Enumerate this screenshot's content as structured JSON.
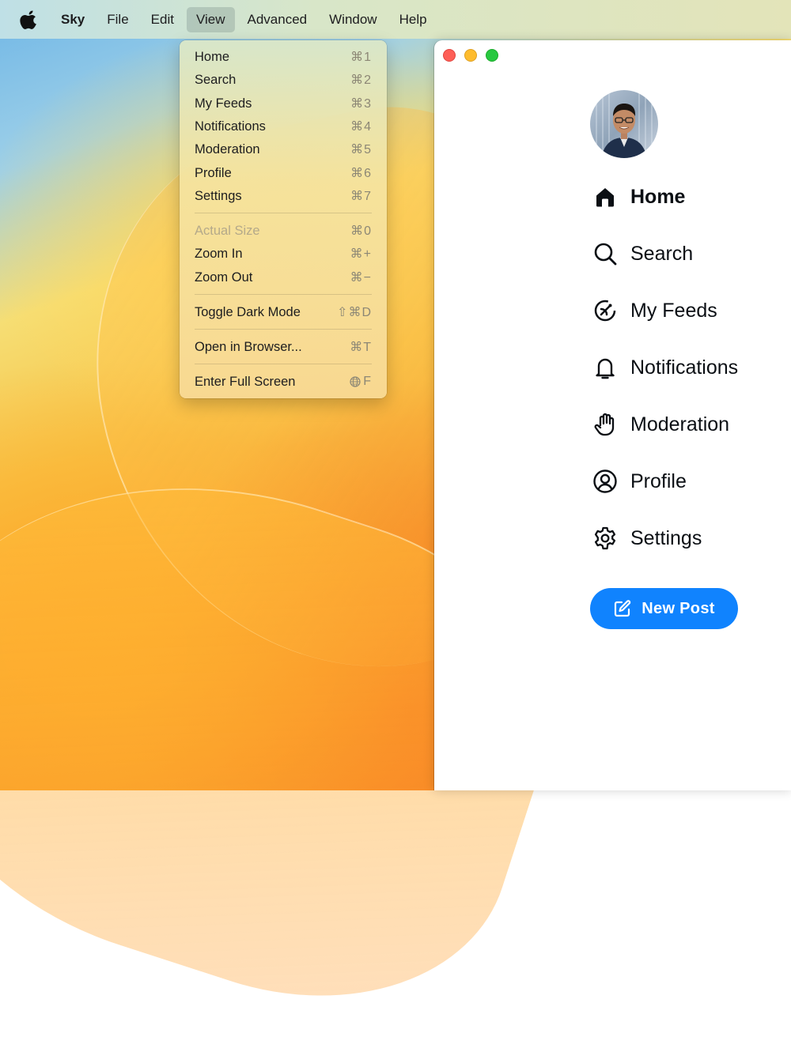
{
  "menubar": {
    "app_name": "Sky",
    "items": [
      "File",
      "Edit",
      "View",
      "Advanced",
      "Window",
      "Help"
    ],
    "active": "View"
  },
  "view_menu": {
    "items": [
      {
        "label": "Home",
        "shortcut": "⌘1",
        "enabled": true
      },
      {
        "label": "Search",
        "shortcut": "⌘2",
        "enabled": true
      },
      {
        "label": "My Feeds",
        "shortcut": "⌘3",
        "enabled": true
      },
      {
        "label": "Notifications",
        "shortcut": "⌘4",
        "enabled": true
      },
      {
        "label": "Moderation",
        "shortcut": "⌘5",
        "enabled": true
      },
      {
        "label": "Profile",
        "shortcut": "⌘6",
        "enabled": true
      },
      {
        "label": "Settings",
        "shortcut": "⌘7",
        "enabled": true
      },
      {
        "label": "Actual Size",
        "shortcut": "⌘0",
        "enabled": false
      },
      {
        "label": "Zoom In",
        "shortcut": "⌘+",
        "enabled": true
      },
      {
        "label": "Zoom Out",
        "shortcut": "⌘−",
        "enabled": true
      },
      {
        "label": "Toggle Dark Mode",
        "shortcut": "⇧⌘D",
        "enabled": true
      },
      {
        "label": "Open in Browser...",
        "shortcut": "⌘T",
        "enabled": true
      },
      {
        "label": "Enter Full Screen",
        "shortcut": "F",
        "enabled": true
      }
    ]
  },
  "sidebar": {
    "items": [
      {
        "label": "Home",
        "icon": "house-icon",
        "active": true
      },
      {
        "label": "Search",
        "icon": "search-icon",
        "active": false
      },
      {
        "label": "My Feeds",
        "icon": "feeds-icon",
        "active": false
      },
      {
        "label": "Notifications",
        "icon": "bell-icon",
        "active": false
      },
      {
        "label": "Moderation",
        "icon": "hand-icon",
        "active": false
      },
      {
        "label": "Profile",
        "icon": "user-circle-icon",
        "active": false
      },
      {
        "label": "Settings",
        "icon": "gear-icon",
        "active": false
      }
    ],
    "new_post_label": "New Post"
  },
  "colors": {
    "accent": "#1083fe",
    "close": "#fe5f57",
    "minimize": "#febc2e",
    "maximize": "#28c840"
  }
}
